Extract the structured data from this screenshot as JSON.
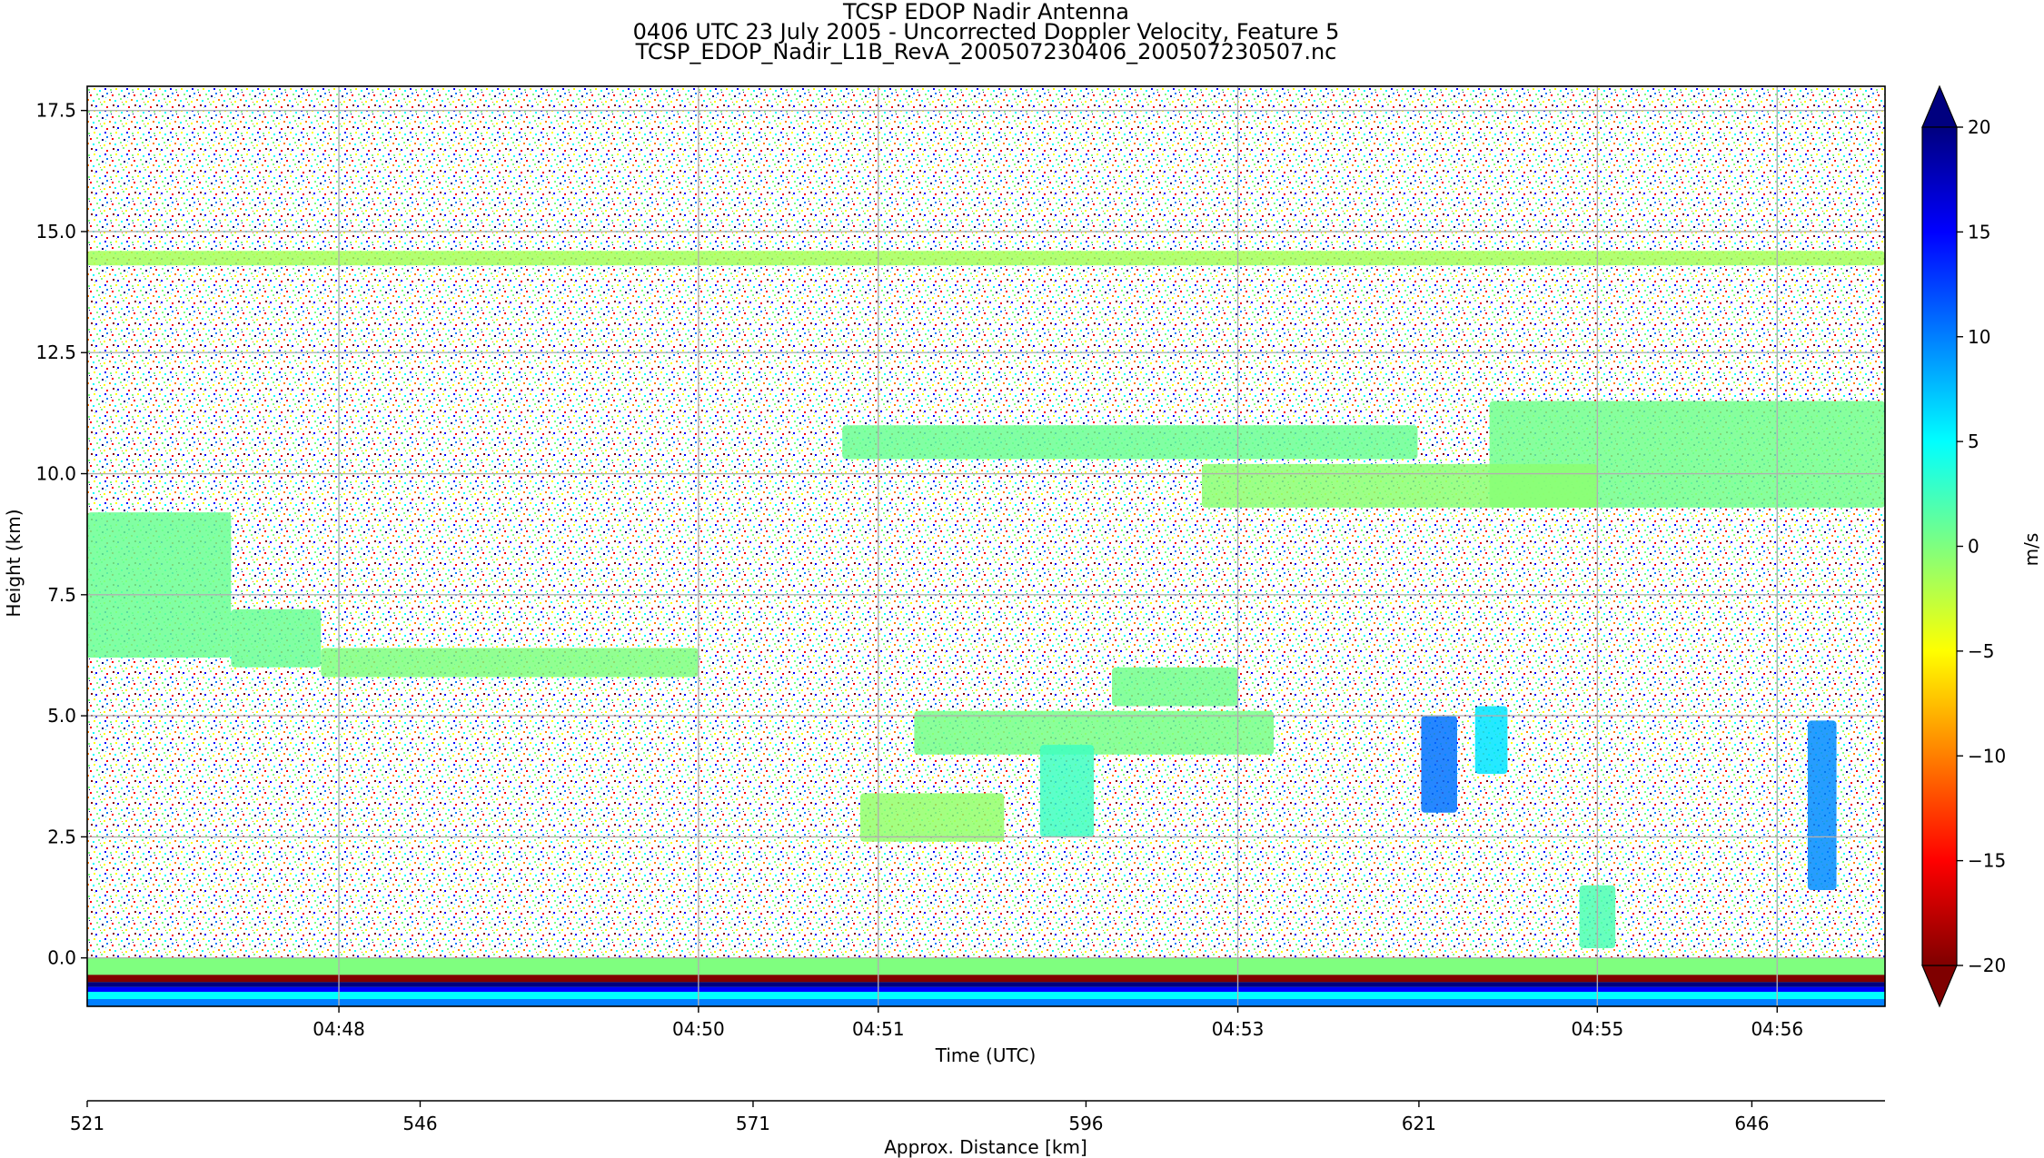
{
  "titles": {
    "line1": "TCSP EDOP Nadir Antenna",
    "line2": "0406 UTC 23 July 2005 - Uncorrected Doppler Velocity, Feature 5",
    "line3": "TCSP_EDOP_Nadir_L1B_RevA_200507230406_200507230507.nc"
  },
  "chart_data": {
    "type": "heatmap",
    "xlabel": "Time (UTC)",
    "ylabel": "Height (km)",
    "secondary_xlabel": "Approx. Distance [km]",
    "colorbar_label": "m/s",
    "ylim": [
      -1.0,
      18.0
    ],
    "y_ticks": [
      0.0,
      2.5,
      5.0,
      7.5,
      10.0,
      12.5,
      15.0,
      17.5
    ],
    "y_tick_labels": [
      "0.0",
      "2.5",
      "5.0",
      "7.5",
      "10.0",
      "12.5",
      "15.0",
      "17.5"
    ],
    "time_range_min": [
      46.6,
      56.6
    ],
    "x_ticks_min": [
      48.0,
      50.0,
      51.0,
      53.0,
      55.0,
      56.0
    ],
    "x_tick_labels": [
      "04:48",
      "04:50",
      "04:51",
      "04:53",
      "04:55",
      "04:56"
    ],
    "distance_range_km": [
      521,
      656
    ],
    "distance_ticks": [
      521,
      546,
      571,
      596,
      621,
      646
    ],
    "distance_tick_labels": [
      "521",
      "546",
      "571",
      "596",
      "621",
      "646"
    ],
    "colorbar_range": [
      -20,
      20
    ],
    "colorbar_ticks": [
      20,
      15,
      10,
      5,
      0,
      -5,
      -10,
      -15,
      -20
    ],
    "colorbar_tick_labels": [
      "20",
      "15",
      "10",
      "5",
      "0",
      "−5",
      "−10",
      "−15",
      "−20"
    ],
    "colormap": "jet_r",
    "colormap_stops": [
      "#00007f",
      "#0000ff",
      "#007fff",
      "#00ffff",
      "#7fff7f",
      "#ffff00",
      "#ff7f00",
      "#ff0000",
      "#7f0000"
    ],
    "grid": true,
    "features": [
      {
        "name": "horizontal band",
        "t_start": 46.6,
        "t_end": 56.6,
        "z_bottom": 14.3,
        "z_top": 14.6,
        "velocity": -1.5
      },
      {
        "name": "upper cirrus layer",
        "t_start": 54.4,
        "t_end": 56.6,
        "z_bottom": 9.3,
        "z_top": 11.5,
        "velocity": 0.5
      },
      {
        "name": "upper cirrus layer",
        "t_start": 52.8,
        "t_end": 55.0,
        "z_bottom": 9.3,
        "z_top": 10.2,
        "velocity": -0.5
      },
      {
        "name": "anvil",
        "t_start": 50.8,
        "t_end": 54.0,
        "z_bottom": 10.3,
        "z_top": 11.0,
        "velocity": 0.8
      },
      {
        "name": "mid-level cloud left",
        "t_start": 46.6,
        "t_end": 47.4,
        "z_bottom": 6.2,
        "z_top": 9.2,
        "velocity": 0.8
      },
      {
        "name": "mid-level cloud left tail",
        "t_start": 47.4,
        "t_end": 47.9,
        "z_bottom": 6.0,
        "z_top": 7.2,
        "velocity": 0.8
      },
      {
        "name": "melting layer",
        "t_start": 47.9,
        "t_end": 50.0,
        "z_bottom": 5.8,
        "z_top": 6.4,
        "velocity": 0.0
      },
      {
        "name": "stratiform layer",
        "t_start": 51.2,
        "t_end": 53.2,
        "z_bottom": 4.2,
        "z_top": 5.1,
        "velocity": 0.3
      },
      {
        "name": "convective cell",
        "t_start": 52.3,
        "t_end": 53.0,
        "z_bottom": 5.2,
        "z_top": 6.0,
        "velocity": 0.5
      },
      {
        "name": "shallow echo",
        "t_start": 50.9,
        "t_end": 51.7,
        "z_bottom": 2.4,
        "z_top": 3.4,
        "velocity": -0.8
      },
      {
        "name": "fallstreak",
        "t_start": 51.9,
        "t_end": 52.2,
        "z_bottom": 2.5,
        "z_top": 4.4,
        "velocity": 2.5
      },
      {
        "name": "updraft core",
        "t_start": 54.02,
        "t_end": 54.22,
        "z_bottom": 3.0,
        "z_top": 5.0,
        "velocity": 10.5
      },
      {
        "name": "updraft core",
        "t_start": 54.32,
        "t_end": 54.5,
        "z_bottom": 3.8,
        "z_top": 5.2,
        "velocity": 6.0
      },
      {
        "name": "updraft core",
        "t_start": 56.17,
        "t_end": 56.33,
        "z_bottom": 1.4,
        "z_top": 4.9,
        "velocity": 9.5
      },
      {
        "name": "low-level echo",
        "t_start": 54.9,
        "t_end": 55.1,
        "z_bottom": 0.2,
        "z_top": 1.5,
        "velocity": 2.0
      }
    ]
  }
}
